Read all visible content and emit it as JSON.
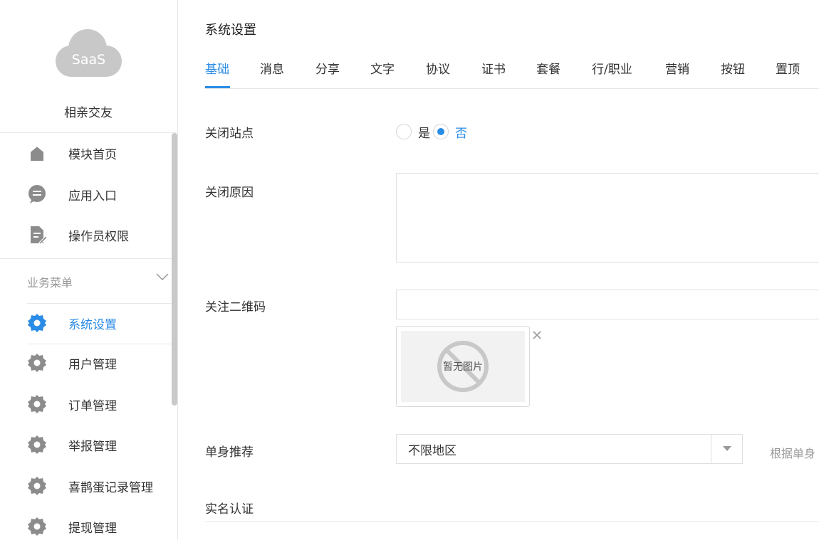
{
  "sidebar": {
    "logo_text": "SaaS",
    "site_name": "相亲交友",
    "top_items": [
      {
        "label": "模块首页",
        "icon": "home-icon"
      },
      {
        "label": "应用入口",
        "icon": "chat-icon"
      },
      {
        "label": "操作员权限",
        "icon": "document-edit-icon"
      }
    ],
    "group_title": "业务菜单",
    "menu_items": [
      {
        "label": "系统设置",
        "icon": "gear-icon",
        "active": true
      },
      {
        "label": "用户管理",
        "icon": "gear-icon"
      },
      {
        "label": "订单管理",
        "icon": "gear-icon"
      },
      {
        "label": "举报管理",
        "icon": "gear-icon"
      },
      {
        "label": "喜鹊蛋记录管理",
        "icon": "gear-icon"
      },
      {
        "label": "提现管理",
        "icon": "gear-icon"
      }
    ]
  },
  "main": {
    "title": "系统设置",
    "tabs": [
      "基础",
      "消息",
      "分享",
      "文字",
      "协议",
      "证书",
      "套餐",
      "行/职业",
      "营销",
      "按钮",
      "置顶"
    ],
    "active_tab": 0,
    "form": {
      "close_site_label": "关闭站点",
      "close_site_options": [
        "是",
        "否"
      ],
      "close_site_selected": "否",
      "close_reason_label": "关闭原因",
      "close_reason_value": "",
      "qrcode_label": "关注二维码",
      "qrcode_value": "",
      "no_image_text": "暂无图片",
      "single_recommend_label": "单身推荐",
      "single_recommend_value": "不限地区",
      "single_recommend_hint": "根据单身",
      "real_name_label": "实名认证"
    }
  },
  "colors": {
    "accent": "#2b8ce6",
    "icon_gray": "#8c8c8c",
    "logo_gray": "#c8c8c8"
  }
}
